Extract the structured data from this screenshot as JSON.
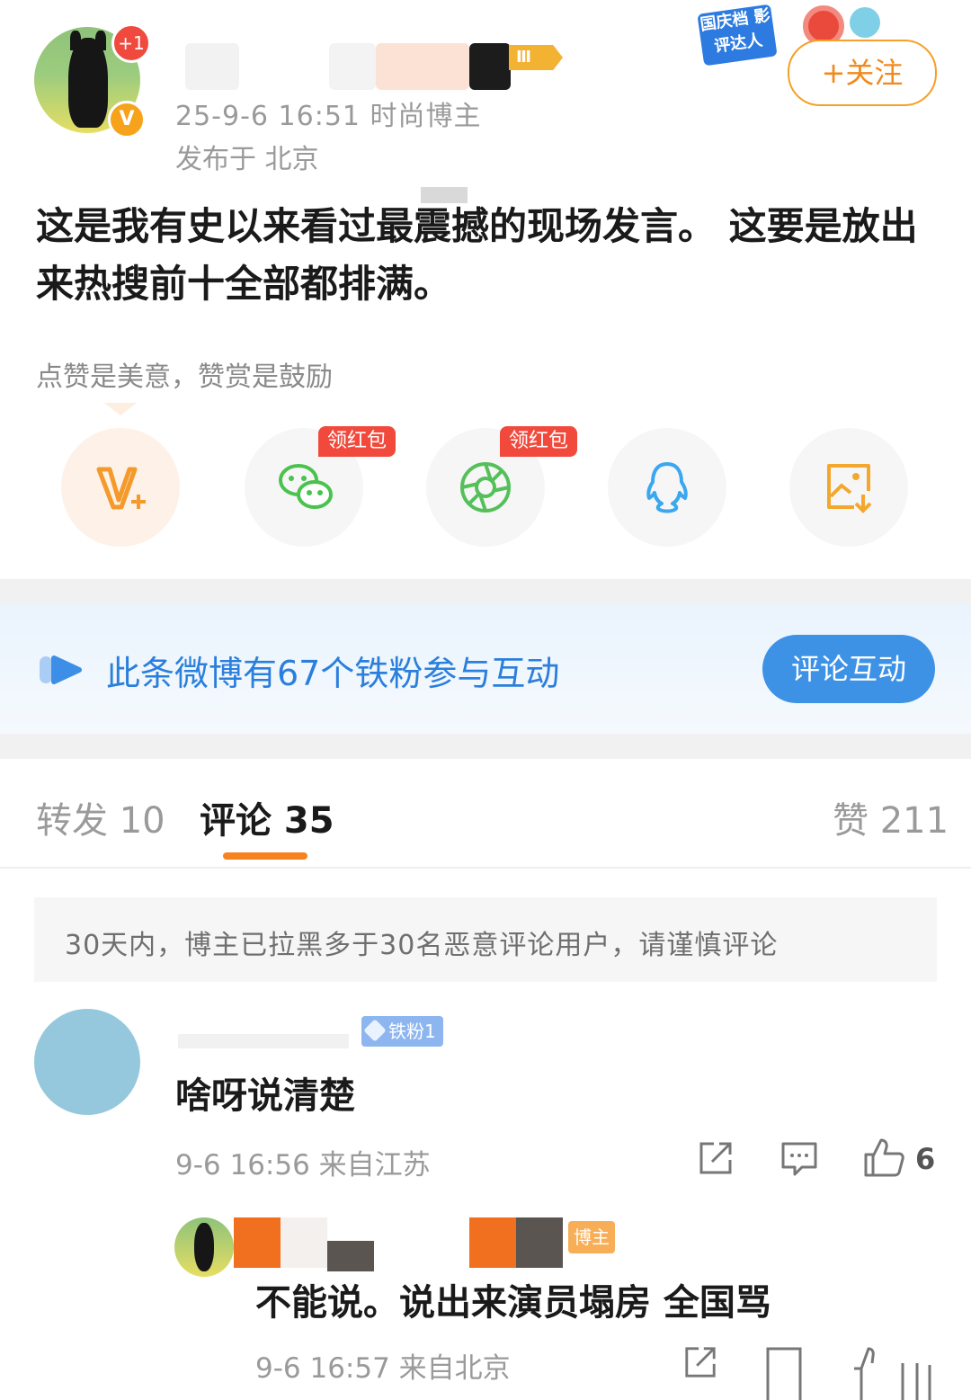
{
  "post": {
    "notification_count": "+1",
    "verified_badge": "V",
    "level_badge": "Ⅲ",
    "time_category": "25-9-6 16:51  时尚博主",
    "location": "发布于 北京",
    "promo_label": "国庆档 影评达人",
    "follow_label": "+关注",
    "text": "这是我有史以来看过最震撼的现场发言。 这要是放出来热搜前十全部都排满。",
    "reward_note": "点赞是美意，赞赏是鼓励"
  },
  "share": {
    "items": [
      {
        "name": "reward-icon",
        "badge": ""
      },
      {
        "name": "wechat-icon",
        "badge": "领红包"
      },
      {
        "name": "moments-icon",
        "badge": "领红包"
      },
      {
        "name": "qq-icon",
        "badge": ""
      },
      {
        "name": "save-image-icon",
        "badge": ""
      }
    ]
  },
  "banner": {
    "text": "此条微博有67个铁粉参与互动",
    "button_label": "评论互动"
  },
  "tabs": {
    "repost": "转发 10",
    "comment": "评论 35",
    "like": "赞 211"
  },
  "notice": "30天内，博主已拉黑多于30名恶意评论用户，请谨慎评论",
  "comment": {
    "fan_badge": "铁粉1",
    "text": "啥呀说清楚",
    "meta": "9-6 16:56  来自江苏",
    "like_count": "6"
  },
  "reply": {
    "tag": "博主",
    "text": "不能说。说出来演员塌房 全国骂",
    "meta": "9-6 16:57  来自北京"
  },
  "colors": {
    "accent_orange": "#f78320",
    "follow_orange": "#f08a1c",
    "link_blue": "#2b7fdc",
    "red_badge": "#f14a3d"
  }
}
